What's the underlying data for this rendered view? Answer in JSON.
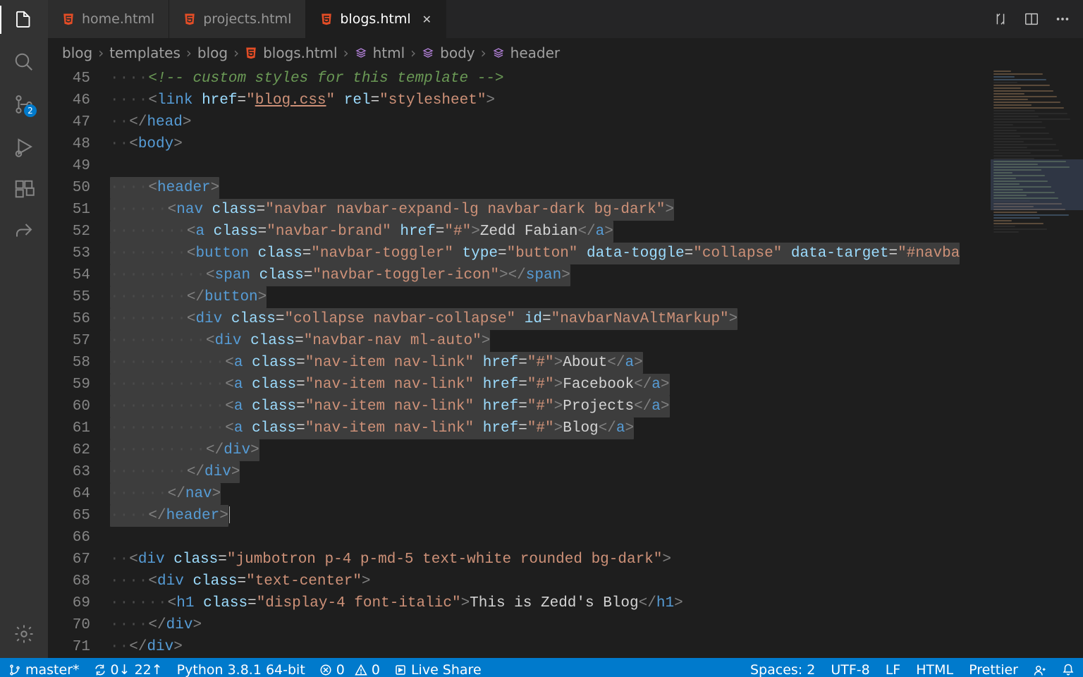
{
  "tabs": [
    {
      "label": "home.html",
      "active": false
    },
    {
      "label": "projects.html",
      "active": false
    },
    {
      "label": "blogs.html",
      "active": true
    }
  ],
  "tab_actions": {
    "compare": "compare-changes-icon",
    "split": "split-editor-icon",
    "more": "more-icon"
  },
  "breadcrumbs": {
    "parts": [
      "blog",
      "templates",
      "blog"
    ],
    "file": "blogs.html",
    "symbols": [
      "html",
      "body",
      "header"
    ]
  },
  "activity": {
    "scm_badge": "2"
  },
  "editor": {
    "first_line_no": 45,
    "comment_fragment": "custom styles for this template",
    "lines": {
      "l45": {
        "pre": "····",
        "comment_end": " -->"
      },
      "l46": {
        "tag": "link",
        "href_attr": "href",
        "href_val": "blog.css",
        "rel_attr": "rel",
        "rel_val": "stylesheet"
      },
      "l47": {
        "close": "head"
      },
      "l48": {
        "open": "body"
      },
      "l49": "",
      "l50": {
        "open": "header"
      },
      "l51": {
        "open": "nav",
        "class_val": "navbar navbar-expand-lg navbar-dark bg-dark"
      },
      "l52": {
        "open": "a",
        "class_val": "navbar-brand",
        "href_val": "#",
        "text": "Zedd Fabian",
        "close": "a"
      },
      "l53": {
        "open": "button",
        "class_val": "navbar-toggler",
        "type_val": "button",
        "dt_attr": "data-toggle",
        "dt_val": "collapse",
        "dtg_attr": "data-target",
        "dtg_val": "#navba"
      },
      "l54": {
        "open": "span",
        "class_val": "navbar-toggler-icon",
        "close": "span"
      },
      "l55": {
        "close": "button"
      },
      "l56": {
        "open": "div",
        "class_val": "collapse navbar-collapse",
        "id_val": "navbarNavAltMarkup"
      },
      "l57": {
        "open": "div",
        "class_val": "navbar-nav ml-auto"
      },
      "l58": {
        "open": "a",
        "class_val": "nav-item nav-link",
        "href_val": "#",
        "text": "About",
        "close": "a"
      },
      "l59": {
        "open": "a",
        "class_val": "nav-item nav-link",
        "href_val": "#",
        "text": "Facebook",
        "close": "a"
      },
      "l60": {
        "open": "a",
        "class_val": "nav-item nav-link",
        "href_val": "#",
        "text": "Projects",
        "close": "a"
      },
      "l61": {
        "open": "a",
        "class_val": "nav-item nav-link",
        "href_val": "#",
        "text": "Blog",
        "close": "a"
      },
      "l62": {
        "close": "div"
      },
      "l63": {
        "close": "div"
      },
      "l64": {
        "close": "nav"
      },
      "l65": {
        "close": "header"
      },
      "l66": "",
      "l67": {
        "open": "div",
        "class_val": "jumbotron p-4 p-md-5 text-white rounded bg-dark"
      },
      "l68": {
        "open": "div",
        "class_val": "text-center"
      },
      "l69": {
        "open": "h1",
        "class_val": "display-4 font-italic",
        "text": "This is Zedd's Blog",
        "close": "h1"
      },
      "l70": {
        "close": "div"
      },
      "l71": {
        "close": "div"
      }
    }
  },
  "status": {
    "branch": "master*",
    "sync": "0↓ 22↑",
    "interpreter": "Python 3.8.1 64-bit",
    "errors": "0",
    "warnings": "0",
    "live_share": "Live Share",
    "spaces": "Spaces: 2",
    "encoding": "UTF-8",
    "eol": "LF",
    "language": "HTML",
    "formatter": "Prettier",
    "feedback": "feedback-icon",
    "bell": "bell-icon"
  },
  "colors": {
    "accent": "#007acc",
    "html_icon": "#e44d26"
  }
}
